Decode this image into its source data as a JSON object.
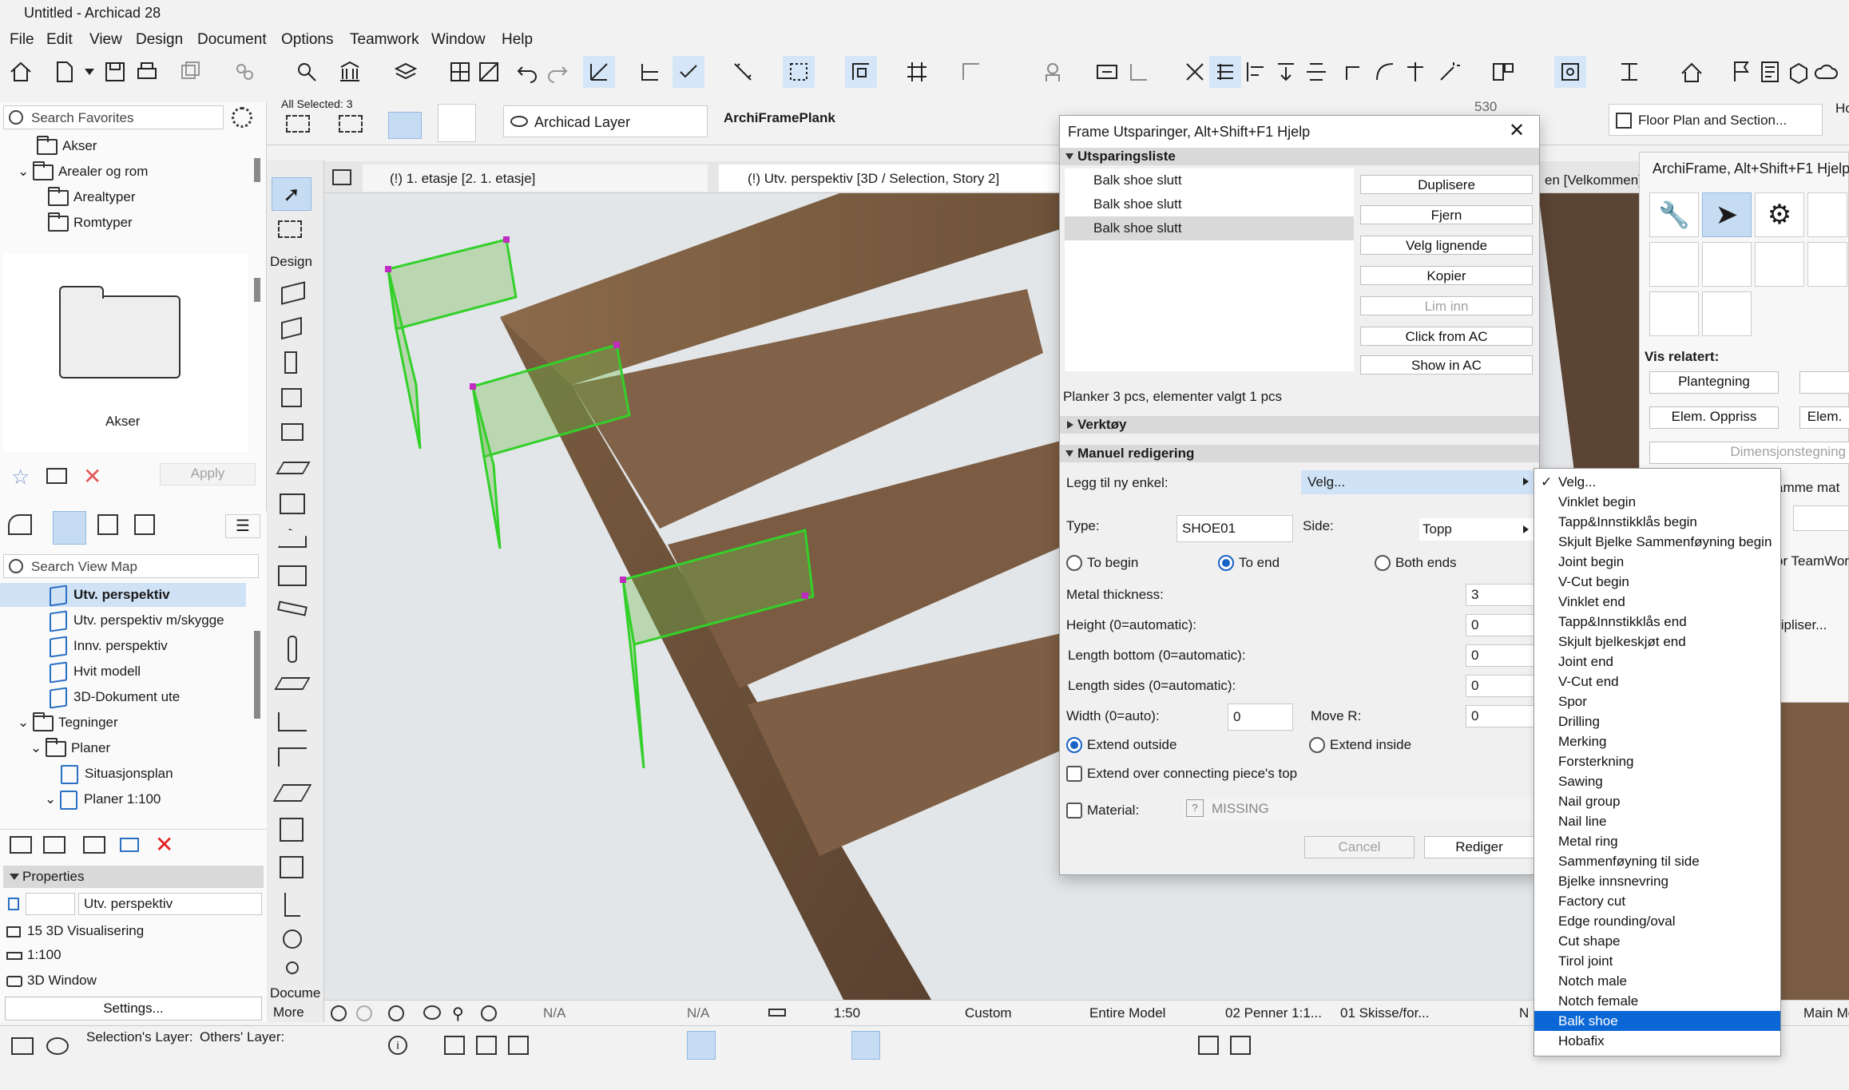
{
  "window": {
    "title": "Untitled - Archicad 28"
  },
  "menu": [
    "File",
    "Edit",
    "View",
    "Design",
    "Document",
    "Options",
    "Teamwork",
    "Window",
    "Help"
  ],
  "infobox": {
    "all_selected": "All Selected: 3",
    "layer": "Archicad Layer",
    "element_name": "ArchiFramePlank",
    "dim_value": "530",
    "floorplan_btn": "Floor Plan and Section...",
    "ho": "Ho"
  },
  "left_panel": {
    "search_placeholder": "Search Favorites",
    "tree": [
      {
        "label": "Akser",
        "indent": 0,
        "arrow": ""
      },
      {
        "label": "Arealer og rom",
        "indent": 0,
        "arrow": "down"
      },
      {
        "label": "Arealtyper",
        "indent": 1,
        "arrow": ""
      },
      {
        "label": "Romtyper",
        "indent": 1,
        "arrow": ""
      }
    ],
    "preview_label": "Akser",
    "apply": "Apply",
    "viewmap_search": "Search View Map",
    "viewmap": [
      {
        "label": "Utv. perspektiv",
        "type": "3d",
        "sel": true
      },
      {
        "label": "Utv. perspektiv m/skygge",
        "type": "3d"
      },
      {
        "label": "Innv. perspektiv",
        "type": "3d"
      },
      {
        "label": "Hvit modell",
        "type": "3d"
      },
      {
        "label": "3D-Dokument ute",
        "type": "3d"
      },
      {
        "label": "Tegninger",
        "type": "folder",
        "arrow": "down"
      },
      {
        "label": "Planer",
        "type": "folder",
        "arrow": "down"
      },
      {
        "label": "Situasjonsplan",
        "type": "plan"
      },
      {
        "label": "Planer 1:100",
        "type": "plan",
        "arrow": "down"
      }
    ],
    "properties_title": "Properties",
    "properties": {
      "name": "Utv. perspektiv",
      "viz": "15 3D Visualisering",
      "scale": "1:100",
      "window": "3D Window",
      "settings": "Settings..."
    }
  },
  "toolbox": {
    "design": "Design",
    "document": "Docume",
    "more": "More"
  },
  "tabs": {
    "tab1": "(!) 1. etasje [2. 1. etasje]",
    "tab2": "(!) Utv. perspektiv [3D / Selection, Story 2]",
    "tab3": "en [Velkommen]"
  },
  "statusbar": {
    "na1": "N/A",
    "na2": "N/A",
    "scale": "1:50",
    "custom": "Custom",
    "model": "Entire Model",
    "pens": "02 Penner 1:1...",
    "sketch": "01 Skisse/for...",
    "n": "N",
    "main": "Main Mc"
  },
  "bottom_bar": {
    "sel_layer": "Selection's Layer:",
    "others_layer": "Others' Layer:"
  },
  "dialog": {
    "title": "Frame Utsparinger, Alt+Shift+F1 Hjelp",
    "section_list": "Utsparingsliste",
    "list": [
      "Balk shoe slutt",
      "Balk shoe slutt",
      "Balk shoe slutt"
    ],
    "buttons": {
      "duplicate": "Duplisere",
      "remove": "Fjern",
      "select_similar": "Velg lignende",
      "copy": "Kopier",
      "paste": "Lim inn",
      "click_from_ac": "Click from AC",
      "show_in_ac": "Show in AC"
    },
    "info": "Planker 3 pcs, elementer valgt 1 pcs",
    "section_tools": "Verktøy",
    "section_manual": "Manuel redigering",
    "add_new_label": "Legg til ny enkel:",
    "add_new_value": "Velg...",
    "type_label": "Type:",
    "type_value": "SHOE01",
    "side_label": "Side:",
    "side_value": "Topp",
    "to_begin": "To begin",
    "to_end": "To end",
    "both_ends": "Both ends",
    "metal_thickness_label": "Metal thickness:",
    "metal_thickness": "3",
    "height_label": "Height (0=automatic):",
    "height": "0",
    "length_bottom_label": "Length bottom (0=automatic):",
    "length_bottom": "0",
    "length_sides_label": "Length sides (0=automatic):",
    "length_sides": "0",
    "width_label": "Width (0=auto):",
    "width": "0",
    "move_r_label": "Move R:",
    "move_r": "0",
    "extend_outside": "Extend outside",
    "extend_inside": "Extend inside",
    "extend_over": "Extend over connecting piece's top",
    "material_label": "Material:",
    "material_value": "MISSING",
    "cancel": "Cancel",
    "edit": "Rediger"
  },
  "dropdown": [
    "Velg...",
    "Vinklet begin",
    "Tapp&Innstikklås begin",
    "Skjult Bjelke Sammenføyning begin",
    "Joint begin",
    "V-Cut begin",
    "Vinklet end",
    "Tapp&Innstikklås end",
    "Skjult bjelkeskjøt end",
    "Joint end",
    "V-Cut end",
    "Spor",
    "Drilling",
    "Merking",
    "Forsterkning",
    "Sawing",
    "Nail group",
    "Nail line",
    "Metal ring",
    "Sammenføyning til side",
    "Bjelke innsnevring",
    "Factory cut",
    "Edge rounding/oval",
    "Cut shape",
    "Tirol joint",
    "Notch male",
    "Notch female",
    "Balk shoe",
    "Hobafix"
  ],
  "dropdown_selected": 27,
  "right_panel": {
    "title": "ArchiFrame, Alt+Shift+F1 Hjelp",
    "vis_relatert": "Vis relatert:",
    "plantegning": "Plantegning",
    "elem_oppriss": "Elem. Oppriss",
    "elem2": "Elem.",
    "dimensjon": "Dimensjonstegning",
    "samme_mat": "amme mat",
    "teamwork": "or TeamWor",
    "multipliser": "tipliser..."
  },
  "colors": {
    "accent": "#0b67d6",
    "selection_green": "#4ccf3a",
    "wood": "#6b5038"
  }
}
